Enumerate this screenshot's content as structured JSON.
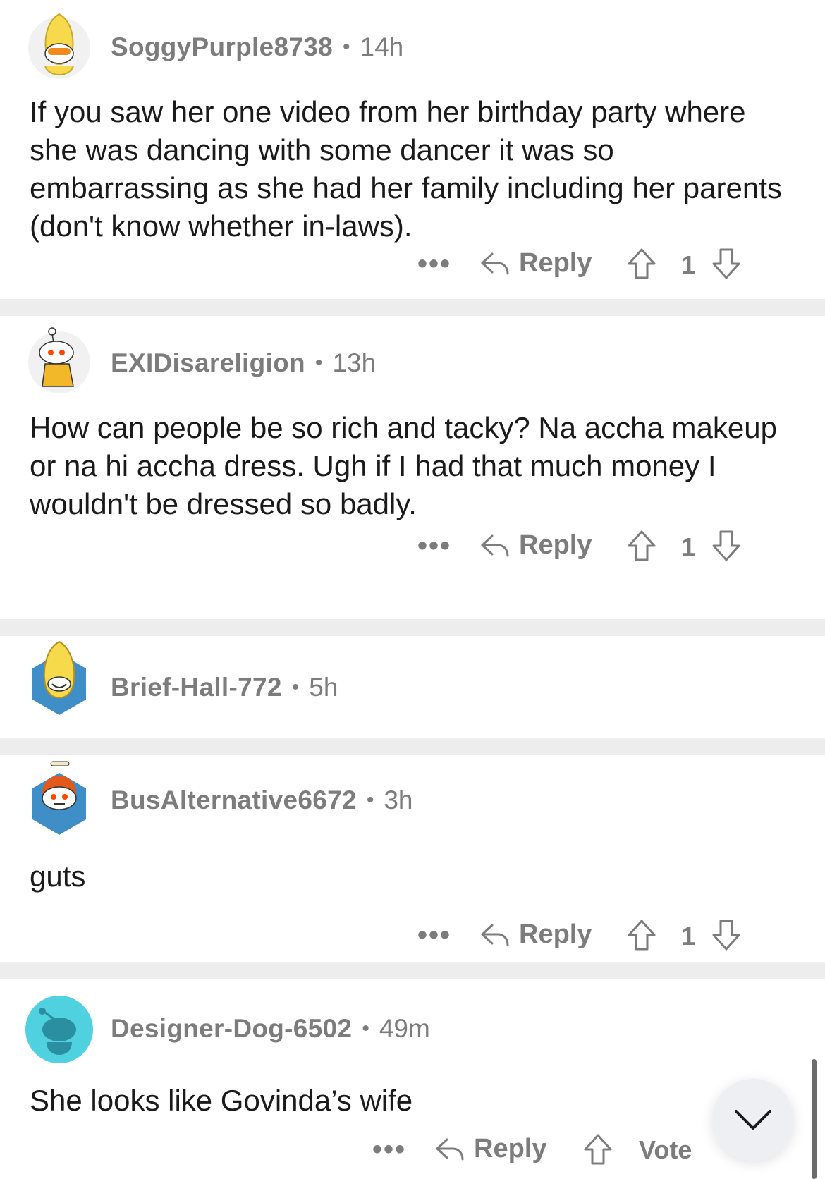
{
  "comments": [
    {
      "username": "SoggyPurple8738",
      "separator": "•",
      "time": "14h",
      "text": "If you saw her one video from her birthday party where she was dancing with some dancer it was so embarrassing as she had her family including her parents (don't know whether in-laws).",
      "more": "•••",
      "reply_label": "Reply",
      "score": "1",
      "avatar_icon": "banana-snoo-avatar-icon"
    },
    {
      "username": "EXIDisareligion",
      "separator": "•",
      "time": "13h",
      "text": "How can people be so rich and tacky? Na accha makeup or na hi accha dress. Ugh if I had that much money I wouldn't be dressed so badly.",
      "more": "•••",
      "reply_label": "Reply",
      "score": "1",
      "avatar_icon": "snoo-avatar-icon"
    },
    {
      "username": "Brief-Hall-772",
      "separator": "•",
      "time": "5h",
      "avatar_icon": "banana-nft-avatar-icon"
    },
    {
      "username": "BusAlternative6672",
      "separator": "•",
      "time": "3h",
      "text": "guts",
      "more": "•••",
      "reply_label": "Reply",
      "score": "1",
      "avatar_icon": "red-hair-snoo-avatar-icon"
    },
    {
      "username": "Designer-Dog-6502",
      "separator": "•",
      "time": "49m",
      "text": "She looks like Govinda’s wife",
      "more": "•••",
      "reply_label": "Reply",
      "vote_label": "Vote",
      "avatar_icon": "default-snoo-avatar-icon"
    }
  ],
  "colors": {
    "meta_gray": "#7c7c7c",
    "separator": "#ededed",
    "default_avatar_bg": "#4fd1e0"
  }
}
